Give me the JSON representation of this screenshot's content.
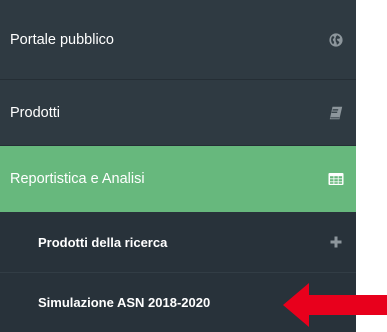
{
  "sidebar": {
    "items": [
      {
        "label": "Portale pubblico",
        "icon": "globe-icon"
      },
      {
        "label": "Prodotti",
        "icon": "book-icon"
      },
      {
        "label": "Reportistica e Analisi",
        "icon": "table-icon",
        "active": true
      }
    ],
    "subitems": [
      {
        "label": "Prodotti della ricerca",
        "icon": "plus-icon"
      },
      {
        "label": "Simulazione ASN 2018-2020",
        "icon": "minus-icon"
      }
    ]
  },
  "colors": {
    "sidebar_bg": "#2f3a42",
    "submenu_bg": "#28323a",
    "active_bg": "#67b87d",
    "icon_muted": "#8d969c",
    "arrow": "#e8001c"
  },
  "annotation": {
    "arrow_icon": "red-arrow-icon"
  }
}
